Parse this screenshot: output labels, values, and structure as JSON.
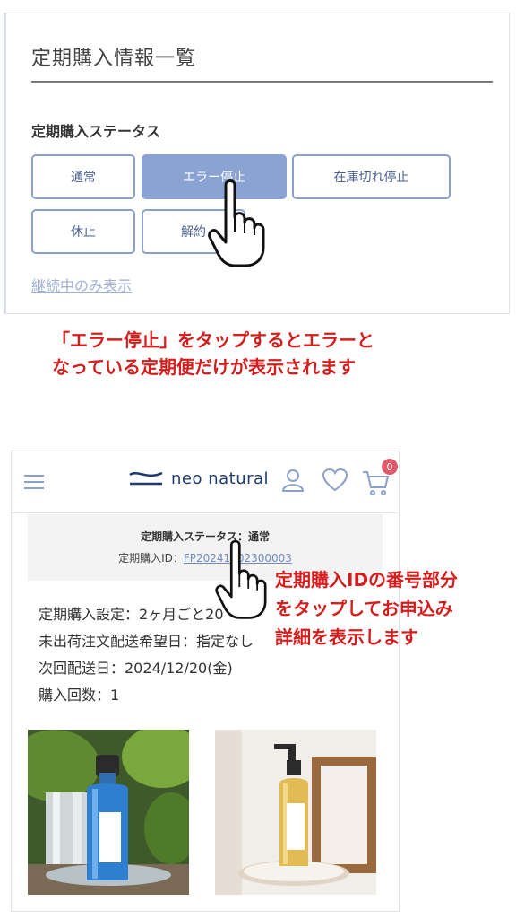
{
  "top_panel": {
    "title": "定期購入情報一覧",
    "status_heading": "定期購入ステータス",
    "status_buttons": [
      {
        "label": "通常"
      },
      {
        "label": "エラー停止"
      },
      {
        "label": "在庫切れ停止"
      },
      {
        "label": "休止"
      },
      {
        "label": "解約"
      }
    ],
    "continuing_only_link": "継続中のみ表示"
  },
  "caption1": {
    "line1": "「エラー停止」をタップするとエラーと",
    "line2": "なっている定期便だけが表示されます"
  },
  "header": {
    "logo_text": "neo natural",
    "cart_count": "0"
  },
  "status_box": {
    "status_line": "定期購入ステータス：通常",
    "id_label": "定期購入ID：",
    "id_value": "FP20241202300003"
  },
  "info": {
    "setting": "定期購入設定：2ヶ月ごと20",
    "delivery_wish": "未出荷注文配送希望日：指定なし",
    "next_delivery": "次回配送日：2024/12/20(金)",
    "purchase_count": "購入回数：1"
  },
  "caption2": {
    "line1": "定期購入IDの番号部分",
    "line2": "をタップしてお申込み",
    "line3": "詳細を表示します"
  },
  "colors": {
    "accent": "#8aa3d3",
    "caption_red": "#d61d1d",
    "brand_navy": "#1e3b6f",
    "badge": "#e05a6b"
  }
}
